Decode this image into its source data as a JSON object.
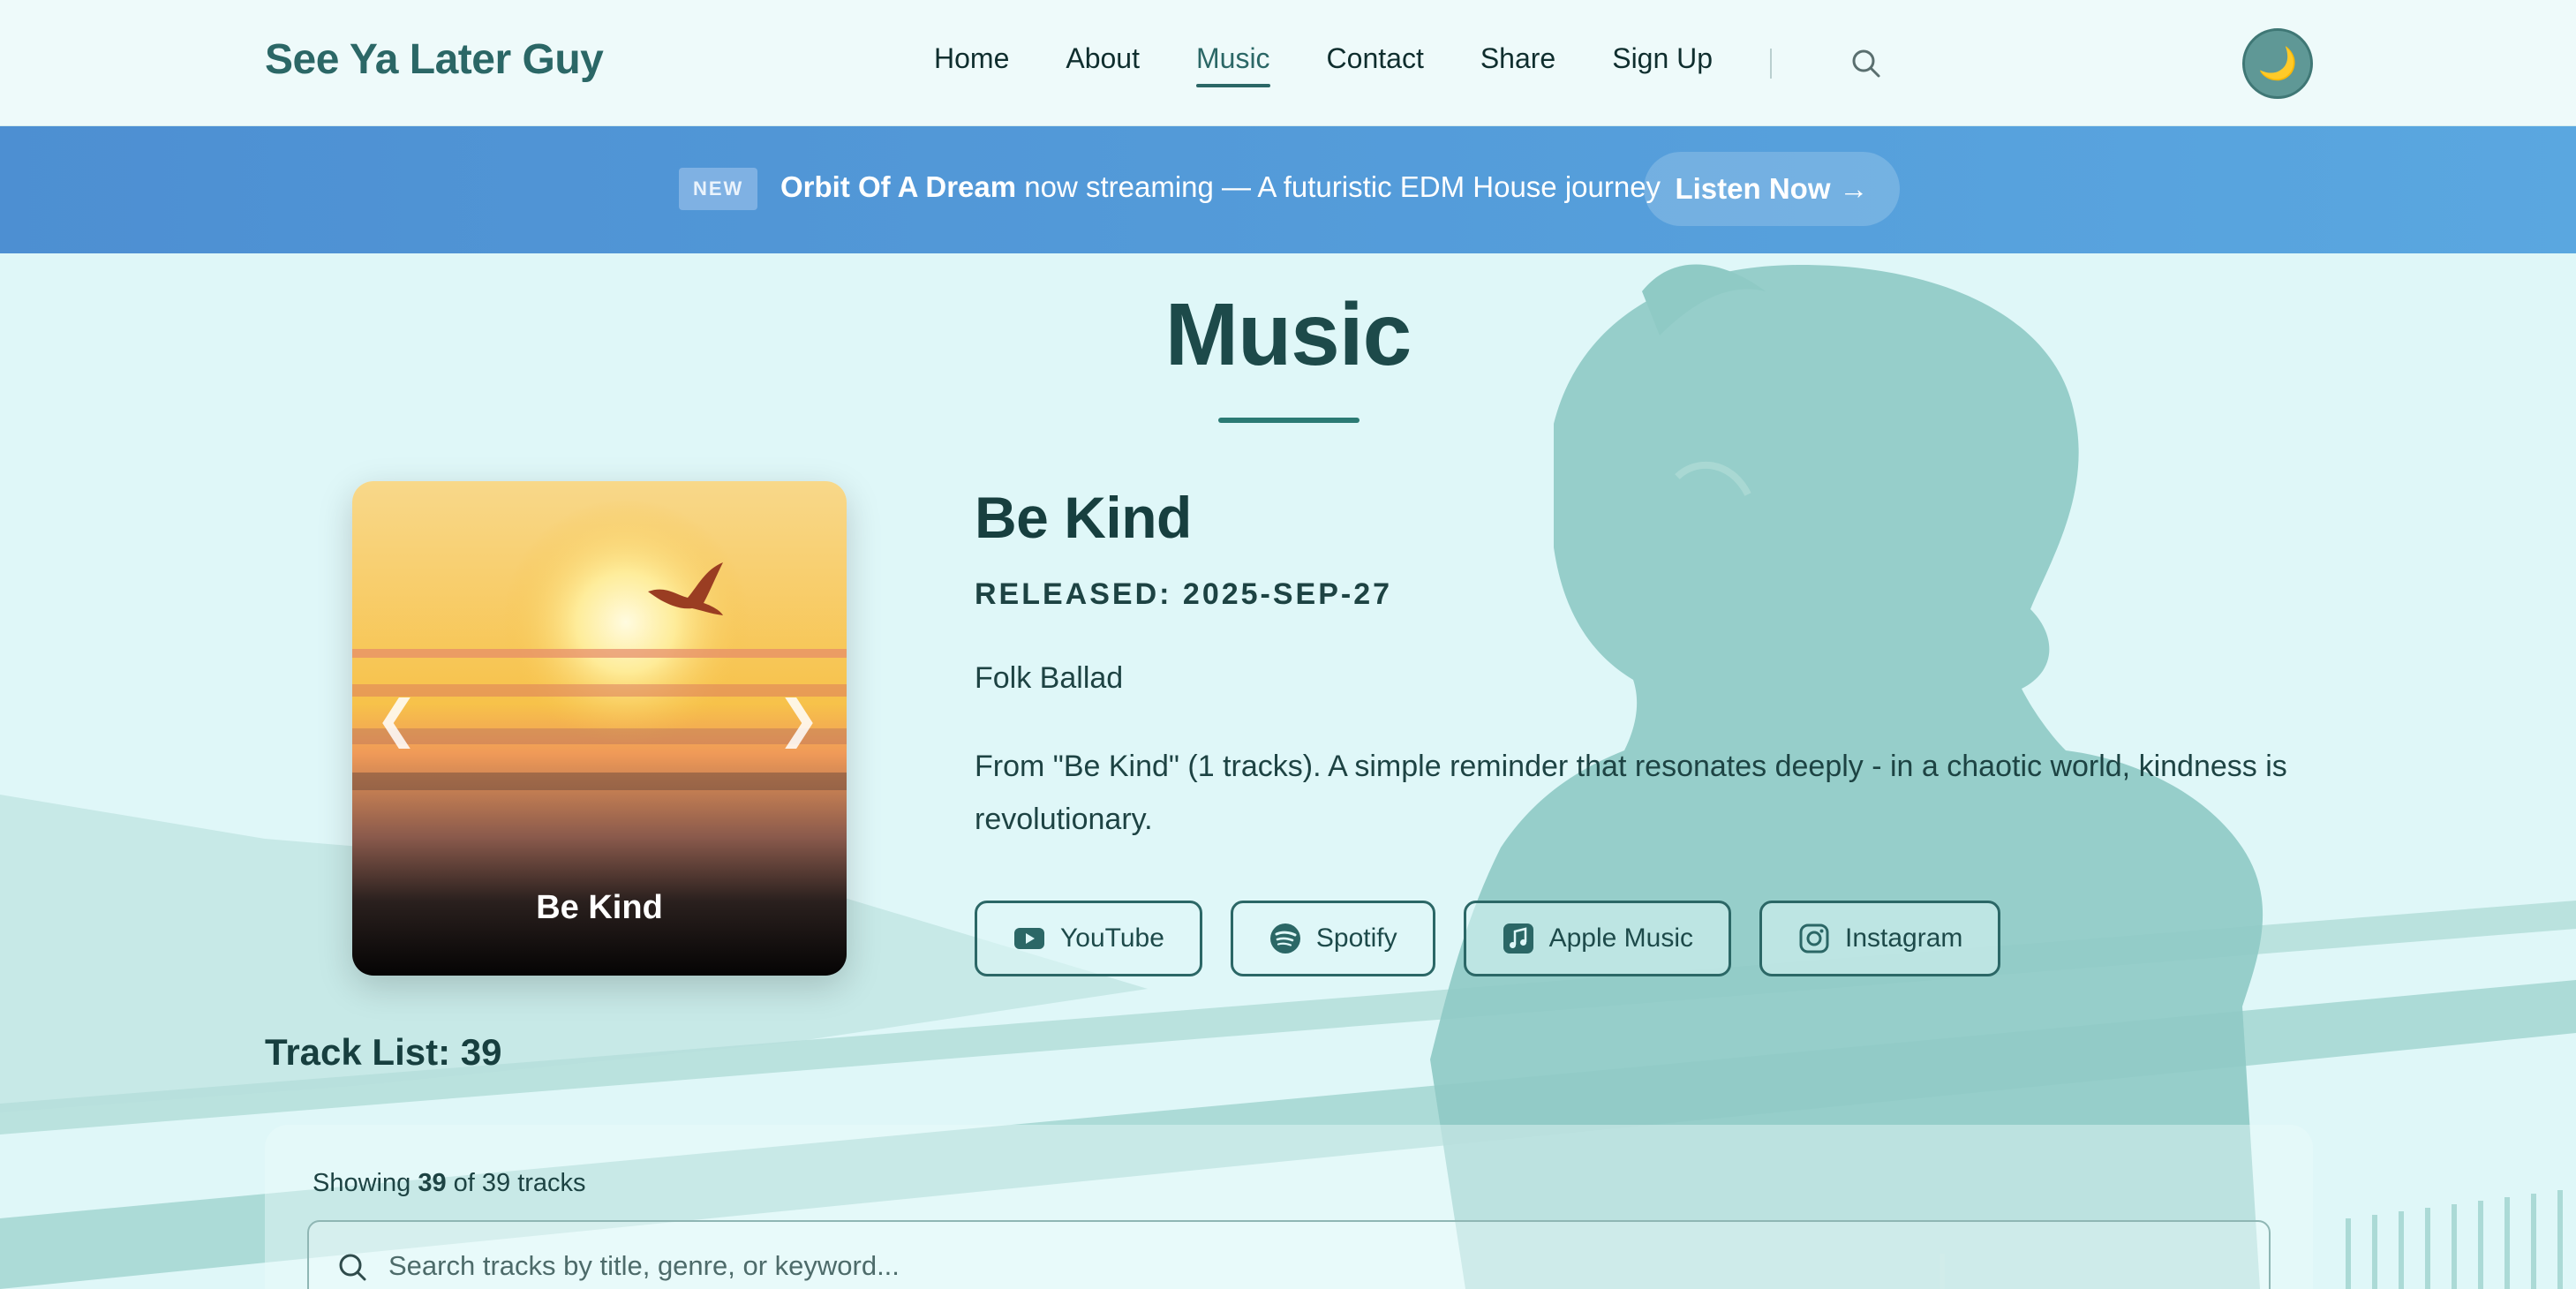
{
  "header": {
    "logo": "See Ya Later Guy",
    "nav": [
      {
        "label": "Home",
        "active": false
      },
      {
        "label": "About",
        "active": false
      },
      {
        "label": "Music",
        "active": true
      },
      {
        "label": "Contact",
        "active": false
      },
      {
        "label": "Share",
        "active": false
      },
      {
        "label": "Sign Up",
        "active": false
      }
    ],
    "theme_icon": "🌙"
  },
  "banner": {
    "badge": "NEW",
    "highlight": "Orbit Of A Dream",
    "text": " now streaming — A futuristic EDM House journey",
    "cta_label": "Listen Now",
    "cta_arrow": "→"
  },
  "main": {
    "page_title": "Music",
    "cover": {
      "caption": "Be Kind",
      "prev": "❮",
      "next": "❯"
    },
    "song": {
      "title": "Be Kind",
      "released": "RELEASED: 2025-SEP-27",
      "genre": "Folk Ballad",
      "description": "From \"Be Kind\" (1 tracks). A simple reminder that resonates deeply - in a chaotic world, kindness is revolutionary."
    },
    "platforms": [
      {
        "label": "YouTube",
        "icon": "youtube-icon"
      },
      {
        "label": "Spotify",
        "icon": "spotify-icon"
      },
      {
        "label": "Apple Music",
        "icon": "apple-music-icon"
      },
      {
        "label": "Instagram",
        "icon": "instagram-icon"
      }
    ],
    "tracklist": {
      "title": "Track List: 39",
      "showing_prefix": "Showing ",
      "showing_count": "39",
      "showing_suffix": " of 39 tracks",
      "search_placeholder": "Search tracks by title, genre, or keyword..."
    }
  },
  "colors": {
    "accent": "#2b6766",
    "banner": "#4d8fd2",
    "background": "#dff7f8",
    "silhouette": "#8fcac5"
  }
}
